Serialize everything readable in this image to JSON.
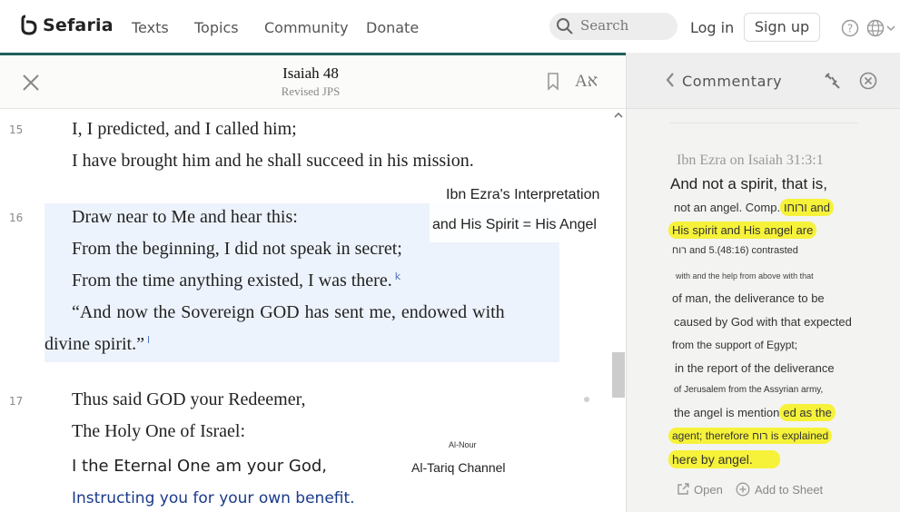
{
  "header": {
    "logo_text": "Sefaria",
    "nav": [
      "Texts",
      "Topics",
      "Community",
      "Donate"
    ],
    "search_placeholder": "Search",
    "login_label": "Log in",
    "signup_label": "Sign up"
  },
  "reader": {
    "title": "Isaiah 48",
    "version": "Revised JPS",
    "text_options_label": "Aא",
    "verses": [
      {
        "num": "15",
        "lines": [
          "I, I predicted, and I called him;",
          "I have brought him and he shall succeed in his mission."
        ]
      },
      {
        "num": "16",
        "lines": [
          "Draw near to Me and hear this:",
          "From the beginning, I did not speak in secret;",
          "From the time anything existed, I was there.",
          "“And now the Sovereign  GOD  has  sent  me,  endowed  with",
          "divine spirit.”"
        ],
        "footnotes": [
          "k",
          "l"
        ]
      },
      {
        "num": "17",
        "lines": [
          "Thus said GOD your Redeemer,",
          "The Holy One of Israel:",
          "I the Eternal One am your God,",
          "Instructing you for your own benefit."
        ]
      }
    ],
    "overlay": {
      "line1": "Ibn Ezra's Interpretation",
      "line2": "and His Spirit = His Angel",
      "small_label": "Al-Nour",
      "channel": "Al-Tariq Channel"
    }
  },
  "commentary": {
    "header_label": "Commentary",
    "source": "Ibn Ezra on Isaiah 31:3:1",
    "lines": [
      "And not a spirit, that is,",
      "not an angel. Comp.",
      "ורוחו and",
      "His spirit and His angel are",
      "רוח and 5.(48:16) contrasted",
      "with and the help from above with that",
      "of man, the deliverance to be",
      "caused by God with that expected",
      "from the support of Egypt;",
      "in the report of the deliverance",
      "of Jerusalem from the Assyrian army,",
      "the angel is mention",
      "ed as the",
      "agent; therefore רוח is explained",
      "here by angel."
    ],
    "open_label": "Open",
    "add_sheet_label": "Add to Sheet"
  },
  "colors": {
    "accent": "#1f5f5b",
    "highlight_yellow": "#f6f23a",
    "verse_highlight": "#edf3fc",
    "footnote_blue": "#4871bf"
  }
}
